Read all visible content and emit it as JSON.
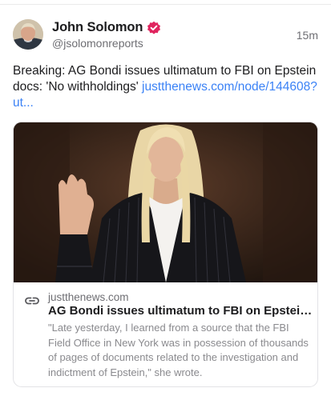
{
  "author": {
    "name": "John Solomon",
    "handle": "@jsolomonreports",
    "verified_color": "#e0245e"
  },
  "post": {
    "timestamp": "15m",
    "text": "Breaking: AG Bondi issues ultimatum to FBI on Epstein docs: 'No withholdings' ",
    "link_text": "justthenews.com/node/144608?ut..."
  },
  "link_card": {
    "domain": "justthenews.com",
    "title": "AG Bondi issues ultimatum to FBI on Epstein do...",
    "description": "\"Late yesterday, I learned from a source that the FBI Field Office in New York was in possession of thousands of pages of documents related to the investigation and indictment of Epstein,\" she wrote.",
    "icon": "link-icon"
  },
  "colors": {
    "link": "#3b82f6",
    "text": "#1c1c1e",
    "muted": "#6e6e73"
  }
}
